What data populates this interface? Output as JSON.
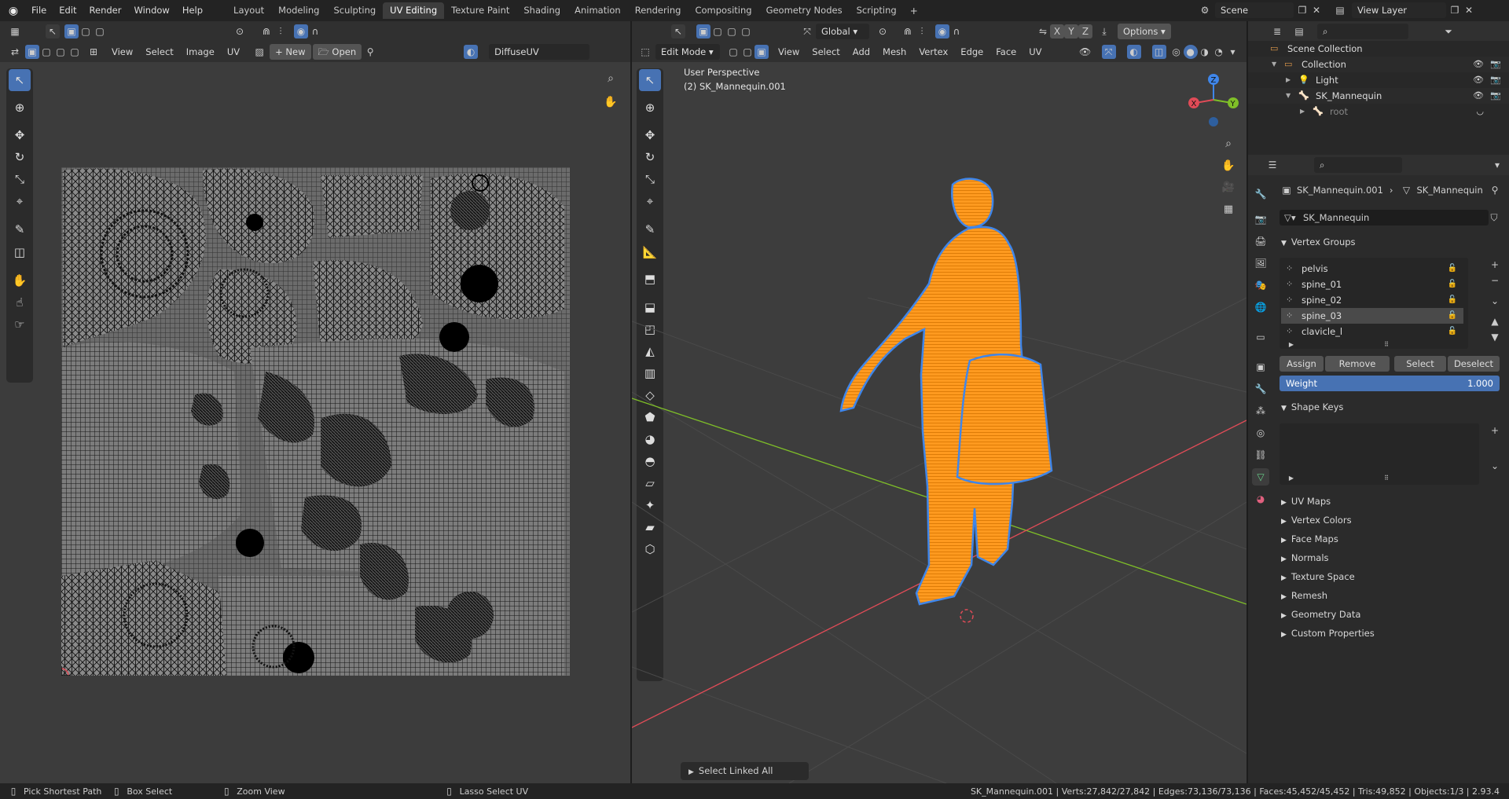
{
  "topbar": {
    "menus": [
      "File",
      "Edit",
      "Render",
      "Window",
      "Help"
    ],
    "workspaces": [
      "Layout",
      "Modeling",
      "Sculpting",
      "UV Editing",
      "Texture Paint",
      "Shading",
      "Animation",
      "Rendering",
      "Compositing",
      "Geometry Nodes",
      "Scripting"
    ],
    "active_workspace": "UV Editing",
    "scene": "Scene",
    "view_layer": "View Layer"
  },
  "uv_editor": {
    "menus": [
      "View",
      "Select",
      "Image",
      "UV"
    ],
    "new_label": "New",
    "open_label": "Open",
    "image_name": "DiffuseUV"
  },
  "viewport": {
    "mode": "Edit Mode",
    "menus": [
      "View",
      "Select",
      "Add",
      "Mesh",
      "Vertex",
      "Edge",
      "Face",
      "UV"
    ],
    "orientation": "Global",
    "options_label": "Options",
    "overlay_title": "User Perspective",
    "overlay_object": "(2) SK_Mannequin.001",
    "axis_labels": [
      "X",
      "Y",
      "Z"
    ],
    "operator_panel": "Select Linked All"
  },
  "outliner": {
    "items": [
      {
        "label": "Scene Collection",
        "icon": "scene-collection-icon",
        "indent": 0
      },
      {
        "label": "Collection",
        "icon": "collection-icon",
        "indent": 1
      },
      {
        "label": "Light",
        "icon": "light-icon",
        "indent": 2
      },
      {
        "label": "SK_Mannequin",
        "icon": "armature-icon",
        "indent": 2
      },
      {
        "label": "root",
        "icon": "bone-icon",
        "indent": 3
      }
    ]
  },
  "properties": {
    "object_name": "SK_Mannequin.001",
    "data_name": "SK_Mannequin",
    "mesh_name": "SK_Mannequin",
    "vertex_groups_title": "Vertex Groups",
    "vertex_groups": [
      "pelvis",
      "spine_01",
      "spine_02",
      "spine_03",
      "clavicle_l"
    ],
    "selected_group": "spine_03",
    "assign": "Assign",
    "remove": "Remove",
    "select": "Select",
    "deselect": "Deselect",
    "weight_label": "Weight",
    "weight_value": "1.000",
    "shape_keys_title": "Shape Keys",
    "collapsed_sections": [
      "UV Maps",
      "Vertex Colors",
      "Face Maps",
      "Normals",
      "Texture Space",
      "Remesh",
      "Geometry Data",
      "Custom Properties"
    ]
  },
  "statusbar": {
    "left": [
      "Pick Shortest Path",
      "Box Select",
      "Zoom View",
      "Lasso Select UV"
    ],
    "stats": "SK_Mannequin.001 | Verts:27,842/27,842 | Edges:73,136/73,136 | Faces:45,452/45,452 | Tris:49,852 | Objects:1/3 | 2.93.4"
  },
  "colors": {
    "accent": "#4772b3",
    "selection": "#ff9a1f",
    "x_axis": "#e04b57",
    "y_axis": "#7fbf28",
    "z_axis": "#3f86ea"
  }
}
